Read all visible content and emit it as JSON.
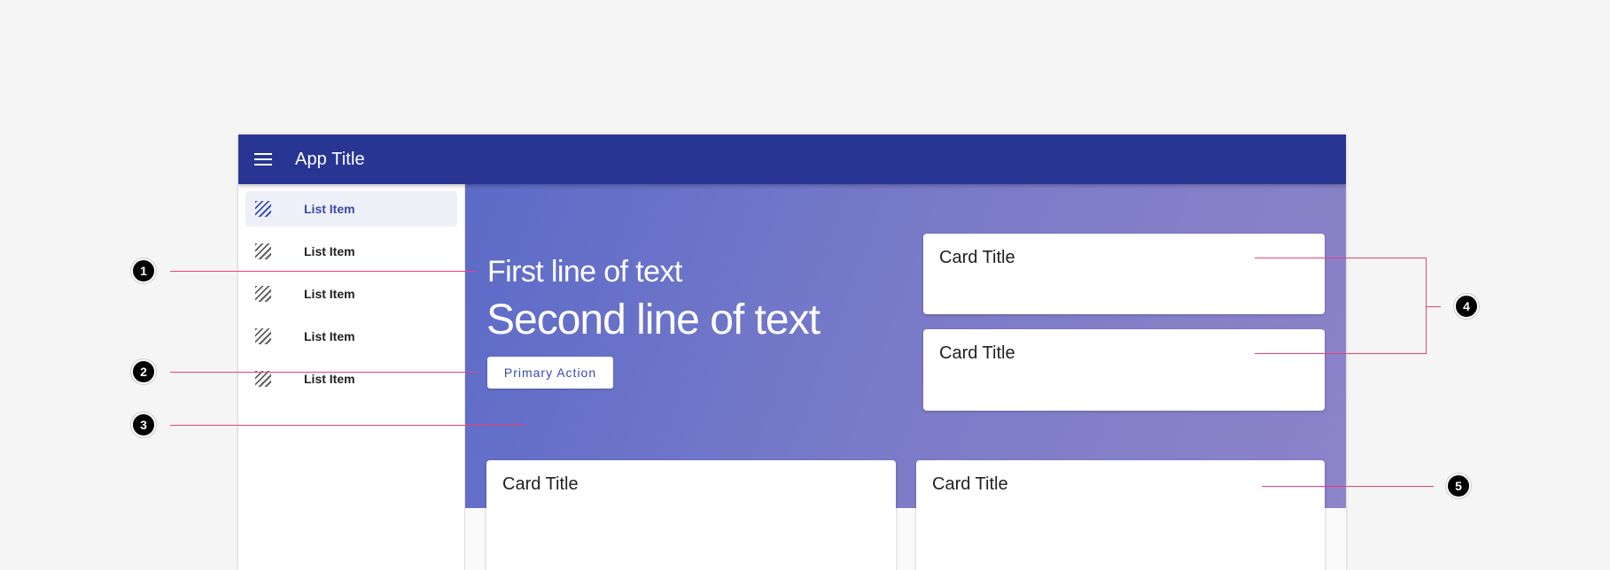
{
  "app": {
    "title": "App Title"
  },
  "drawer": {
    "items": [
      {
        "label": "List Item",
        "active": true
      },
      {
        "label": "List Item",
        "active": false
      },
      {
        "label": "List Item",
        "active": false
      },
      {
        "label": "List Item",
        "active": false
      },
      {
        "label": "List Item",
        "active": false
      }
    ]
  },
  "hero": {
    "line1": "First line of text",
    "line2": "Second line of text",
    "primary_action": "Primary Action"
  },
  "cards": {
    "top": [
      {
        "title": "Card Title"
      },
      {
        "title": "Card Title"
      }
    ],
    "bottom": [
      {
        "title": "Card Title"
      },
      {
        "title": "Card Title"
      }
    ]
  },
  "annotations": [
    "1",
    "2",
    "3",
    "4",
    "5"
  ],
  "colors": {
    "topbar": "#283593",
    "accent": "#3949ab",
    "annotation_line": "#ec407a",
    "background": "#f5f5f5"
  }
}
